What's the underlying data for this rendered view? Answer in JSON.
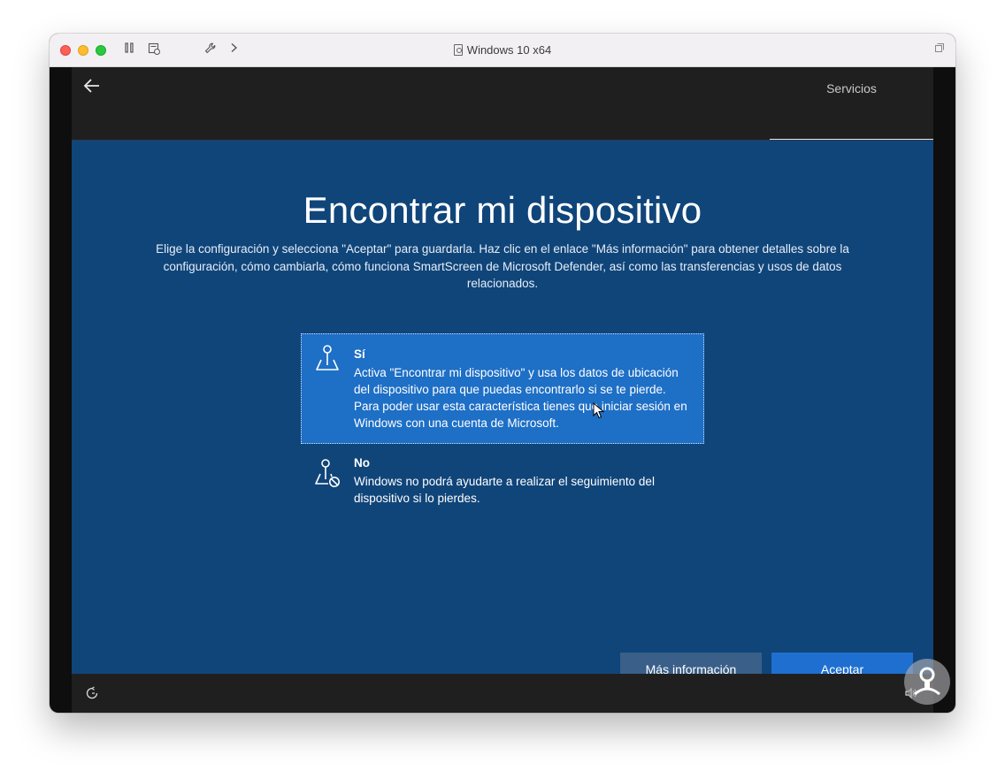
{
  "titlebar": {
    "title": "Windows 10 x64",
    "icons": [
      "pause-icon",
      "snapshot-icon",
      "wrench-icon",
      "chevron-right-icon",
      "resize-icon"
    ]
  },
  "oobe": {
    "step_label": "Servicios",
    "back_icon": "back-arrow-icon",
    "title": "Encontrar mi dispositivo",
    "description": "Elige la configuración y selecciona \"Aceptar\" para guardarla. Haz clic en el enlace \"Más información\" para obtener detalles sobre la configuración, cómo cambiarla, cómo funciona SmartScreen de Microsoft Defender, así como las transferencias y usos de datos relacionados.",
    "options": [
      {
        "title": "Sí",
        "text": "Activa \"Encontrar mi dispositivo\" y usa los datos de ubicación del dispositivo para que puedas encontrarlo si se te pierde. Para poder usar esta característica tienes que iniciar sesión en Windows con una cuenta de Microsoft.",
        "icon": "location-pin-map-icon",
        "selected": true
      },
      {
        "title": "No",
        "text": "Windows no podrá ayudarte a realizar el seguimiento del dispositivo si lo pierdes.",
        "icon": "location-pin-blocked-icon",
        "selected": false
      }
    ],
    "buttons": {
      "more_info": "Más información",
      "accept": "Aceptar"
    },
    "bottom_icons": [
      "accessibility-icon",
      "volume-icon"
    ]
  },
  "colors": {
    "background": "#10457a",
    "selected_option": "#1e6fc6",
    "accept_button": "#1e6fd0",
    "more_info_button": "#3a5f88",
    "top_bar": "#1f1f1f"
  }
}
